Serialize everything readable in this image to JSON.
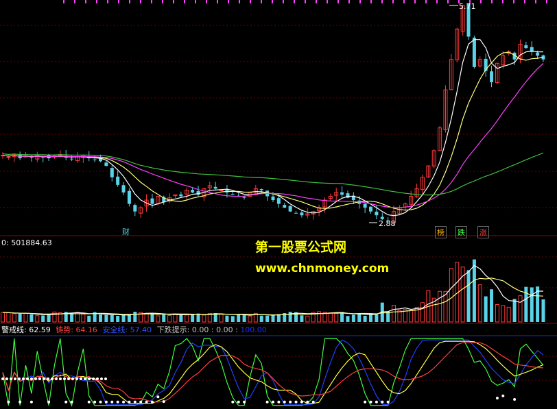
{
  "colors": {
    "up": "#ff3b3b",
    "down": "#5ad2e8",
    "ma_white": "#ffffff",
    "ma_yellow": "#ffff80",
    "ma_magenta": "#ff40ff",
    "ma_green": "#40c040",
    "grid": "#8b0000",
    "jingjie": "#ffffff",
    "zhushi": "#ff4040",
    "anquan": "#4040ff",
    "xiadie": "#c0c0c0",
    "line_green": "#40ff40",
    "line_blue": "#2040ff",
    "line_yellow": "#ffff40"
  },
  "price_panel": {
    "high_label": "5.71",
    "low_label": "2.88",
    "event_cai": "财",
    "event_bang": "榜",
    "event_die": "跌",
    "event_zhang": "涨"
  },
  "volume_panel": {
    "label": "0: 501884.63"
  },
  "indicator_panel": {
    "jingjie_label": "警戒线:",
    "jingjie_value": "62.59",
    "zhushi_label": "铸势:",
    "zhushi_value": "64.16",
    "anquan_label": "安全线:",
    "anquan_value": "57.40",
    "xiadie_label": "下跌提示:",
    "xiadie_value1": "0.00",
    "xiadie_sep": ":",
    "xiadie_value2": "0.00",
    "xiadie_value3": "100.00"
  },
  "watermark": {
    "title": "第一股票公式网",
    "url": "www.chnmoney.com"
  },
  "chart_data": {
    "type": "candlestick",
    "closes": [
      3.74,
      3.72,
      3.75,
      3.7,
      3.73,
      3.71,
      3.74,
      3.72,
      3.7,
      3.73,
      3.75,
      3.71,
      3.69,
      3.72,
      3.74,
      3.7,
      3.68,
      3.66,
      3.6,
      3.45,
      3.35,
      3.25,
      3.1,
      3.0,
      3.05,
      3.15,
      3.1,
      3.2,
      3.12,
      3.18,
      3.22,
      3.2,
      3.28,
      3.25,
      3.22,
      3.3,
      3.34,
      3.3,
      3.28,
      3.25,
      3.22,
      3.2,
      3.18,
      3.25,
      3.3,
      3.28,
      3.2,
      3.15,
      3.1,
      3.05,
      3.0,
      2.98,
      2.95,
      2.97,
      3.0,
      3.05,
      3.15,
      3.2,
      3.25,
      3.22,
      3.18,
      3.15,
      3.1,
      3.05,
      3.0,
      2.95,
      2.9,
      2.88,
      3.0,
      3.05,
      3.1,
      3.2,
      3.3,
      3.45,
      3.6,
      3.8,
      4.1,
      4.6,
      5.0,
      5.4,
      5.71,
      5.3,
      4.9,
      5.0,
      4.85,
      4.7,
      4.95,
      5.05,
      5.1,
      5.0,
      5.2,
      5.15,
      5.1,
      5.05,
      5.0
    ],
    "high": "5.71",
    "low": "2.88"
  }
}
